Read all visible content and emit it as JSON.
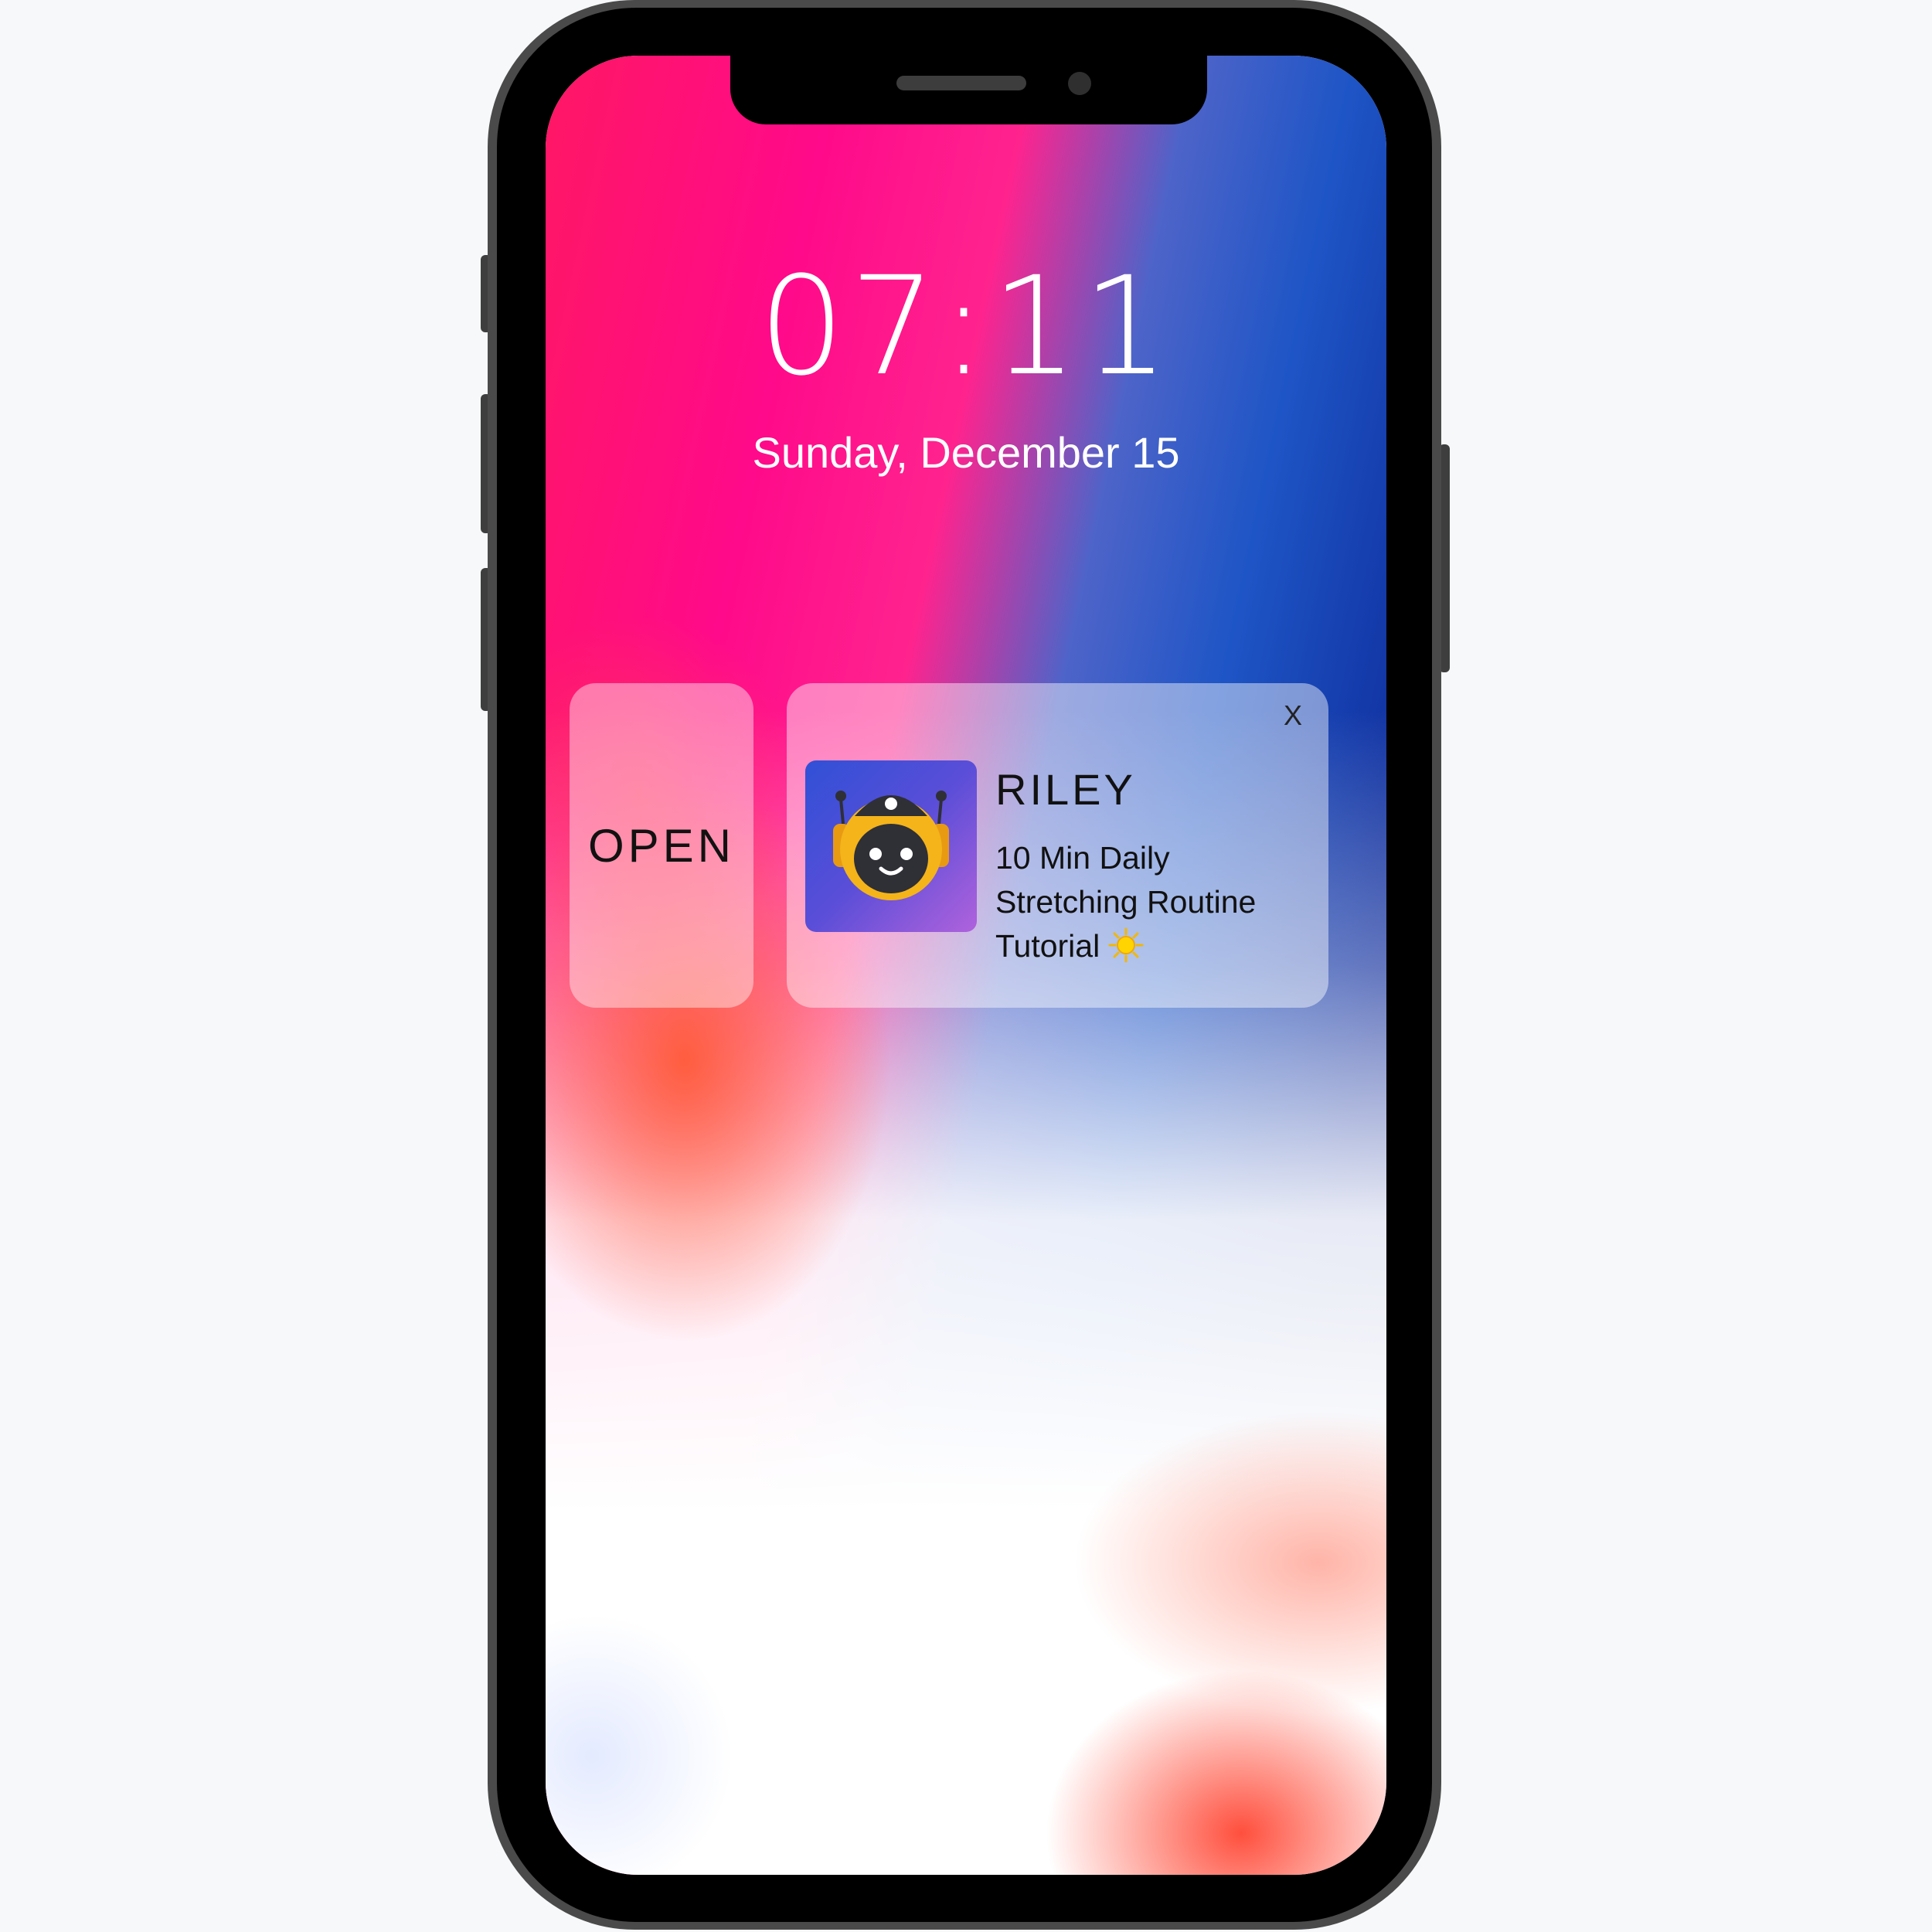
{
  "lock_screen": {
    "time": "07:11",
    "date": "Sunday, December 15"
  },
  "actions": {
    "open_label": "OPEN",
    "close_label": "X"
  },
  "notification": {
    "sender": "RILEY",
    "message_lines": [
      "10 Min Daily",
      "Stretching Routine",
      "Tutorial"
    ],
    "app_icon": "robot-avatar-icon",
    "emoji_icon": "sun-icon"
  },
  "colors": {
    "icon_gradient_start": "#3050d6",
    "icon_gradient_end": "#b062dc",
    "robot_head": "#f4b41a",
    "robot_face": "#2f2f36"
  }
}
